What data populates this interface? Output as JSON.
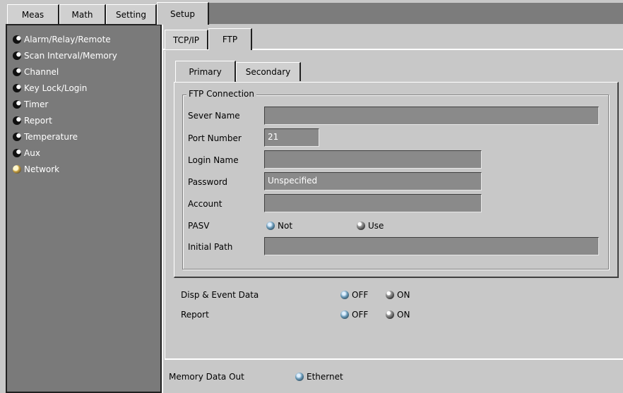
{
  "top_tabs": [
    {
      "label": "Meas",
      "active": false
    },
    {
      "label": "Math",
      "active": false
    },
    {
      "label": "Setting",
      "active": false
    },
    {
      "label": "Setup",
      "active": true
    }
  ],
  "sidebar": {
    "items": [
      {
        "label": "Alarm/Relay/Remote",
        "icon": "bullet-icon"
      },
      {
        "label": "Scan Interval/Memory",
        "icon": "bullet-icon"
      },
      {
        "label": "Channel",
        "icon": "bullet-icon"
      },
      {
        "label": "Key Lock/Login",
        "icon": "bullet-icon"
      },
      {
        "label": "Timer",
        "icon": "bullet-icon"
      },
      {
        "label": "Report",
        "icon": "bullet-icon"
      },
      {
        "label": "Temperature",
        "icon": "bullet-icon"
      },
      {
        "label": "Aux",
        "icon": "bullet-icon"
      },
      {
        "label": "Network",
        "icon": "network-icon"
      }
    ]
  },
  "sub_tabs": [
    {
      "label": "TCP/IP",
      "active": false
    },
    {
      "label": "FTP",
      "active": true
    }
  ],
  "inner_tabs": [
    {
      "label": "Primary",
      "active": true
    },
    {
      "label": "Secondary",
      "active": false
    }
  ],
  "ftp_connection": {
    "group_title": "FTP Connection",
    "server_name": {
      "label": "Sever Name",
      "value": ""
    },
    "port_number": {
      "label": "Port Number",
      "value": "21"
    },
    "login_name": {
      "label": "Login Name",
      "value": ""
    },
    "password": {
      "label": "Password",
      "value": "Unspecified"
    },
    "account": {
      "label": "Account",
      "value": ""
    },
    "pasv": {
      "label": "PASV",
      "options": [
        "Not",
        "Use"
      ],
      "selected": "Not"
    },
    "initial_path": {
      "label": "Initial Path",
      "value": ""
    }
  },
  "disp_event": {
    "label": "Disp & Event Data",
    "options": [
      "OFF",
      "ON"
    ],
    "selected": "OFF"
  },
  "report": {
    "label": "Report",
    "options": [
      "OFF",
      "ON"
    ],
    "selected": "OFF"
  },
  "memory_data_out": {
    "label": "Memory Data Out",
    "option": "Ethernet"
  }
}
